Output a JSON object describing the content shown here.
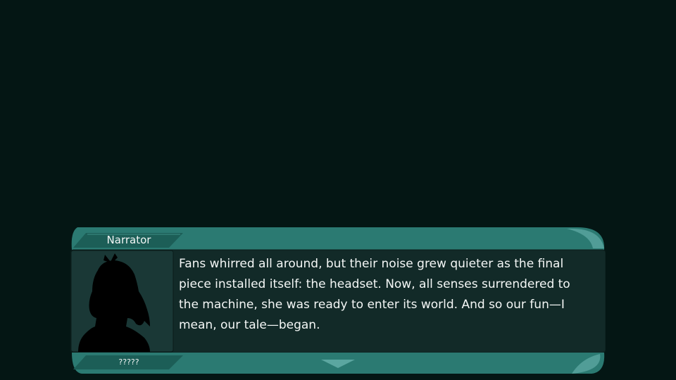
{
  "dialogue": {
    "speaker": "Narrator",
    "text": "Fans whirred all around, but their noise grew quieter as the final piece installed itself: the headset. Now, all senses surrendered to the machine, she was ready to enter its world. And so our fun—I mean, our tale—began.",
    "portrait_label": "?????"
  },
  "icons": {
    "advance": "chevron-down-icon",
    "portrait": "silhouette-portrait"
  },
  "colors": {
    "background": "#041614",
    "frame": "#2b7a72",
    "frame_light": "#5ba6a0",
    "panel": "#122a28",
    "text": "#f4f7f6"
  }
}
